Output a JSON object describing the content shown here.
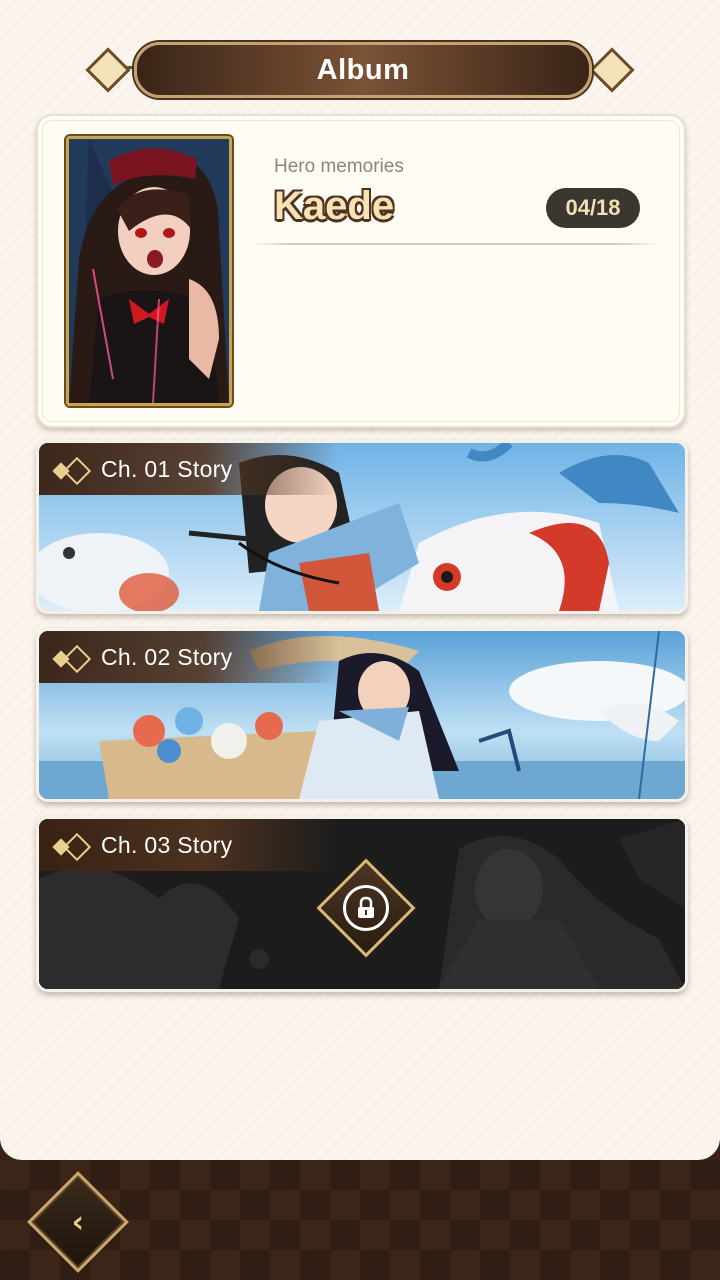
{
  "header": {
    "title": "Album"
  },
  "hero": {
    "label": "Hero memories",
    "name": "Kaede",
    "count": "04/18"
  },
  "chapters": [
    {
      "label": "Ch. 01 Story",
      "locked": false
    },
    {
      "label": "Ch. 02 Story",
      "locked": false
    },
    {
      "label": "Ch. 03 Story",
      "locked": true
    }
  ],
  "icons": {
    "back": "back-arrow-icon",
    "lock": "lock-icon",
    "chapter": "chevron-diamond-icon"
  },
  "colors": {
    "accent_gold": "#c9a86a",
    "panel_bg": "#fbf5ee",
    "brown_dark": "#3b2518"
  }
}
